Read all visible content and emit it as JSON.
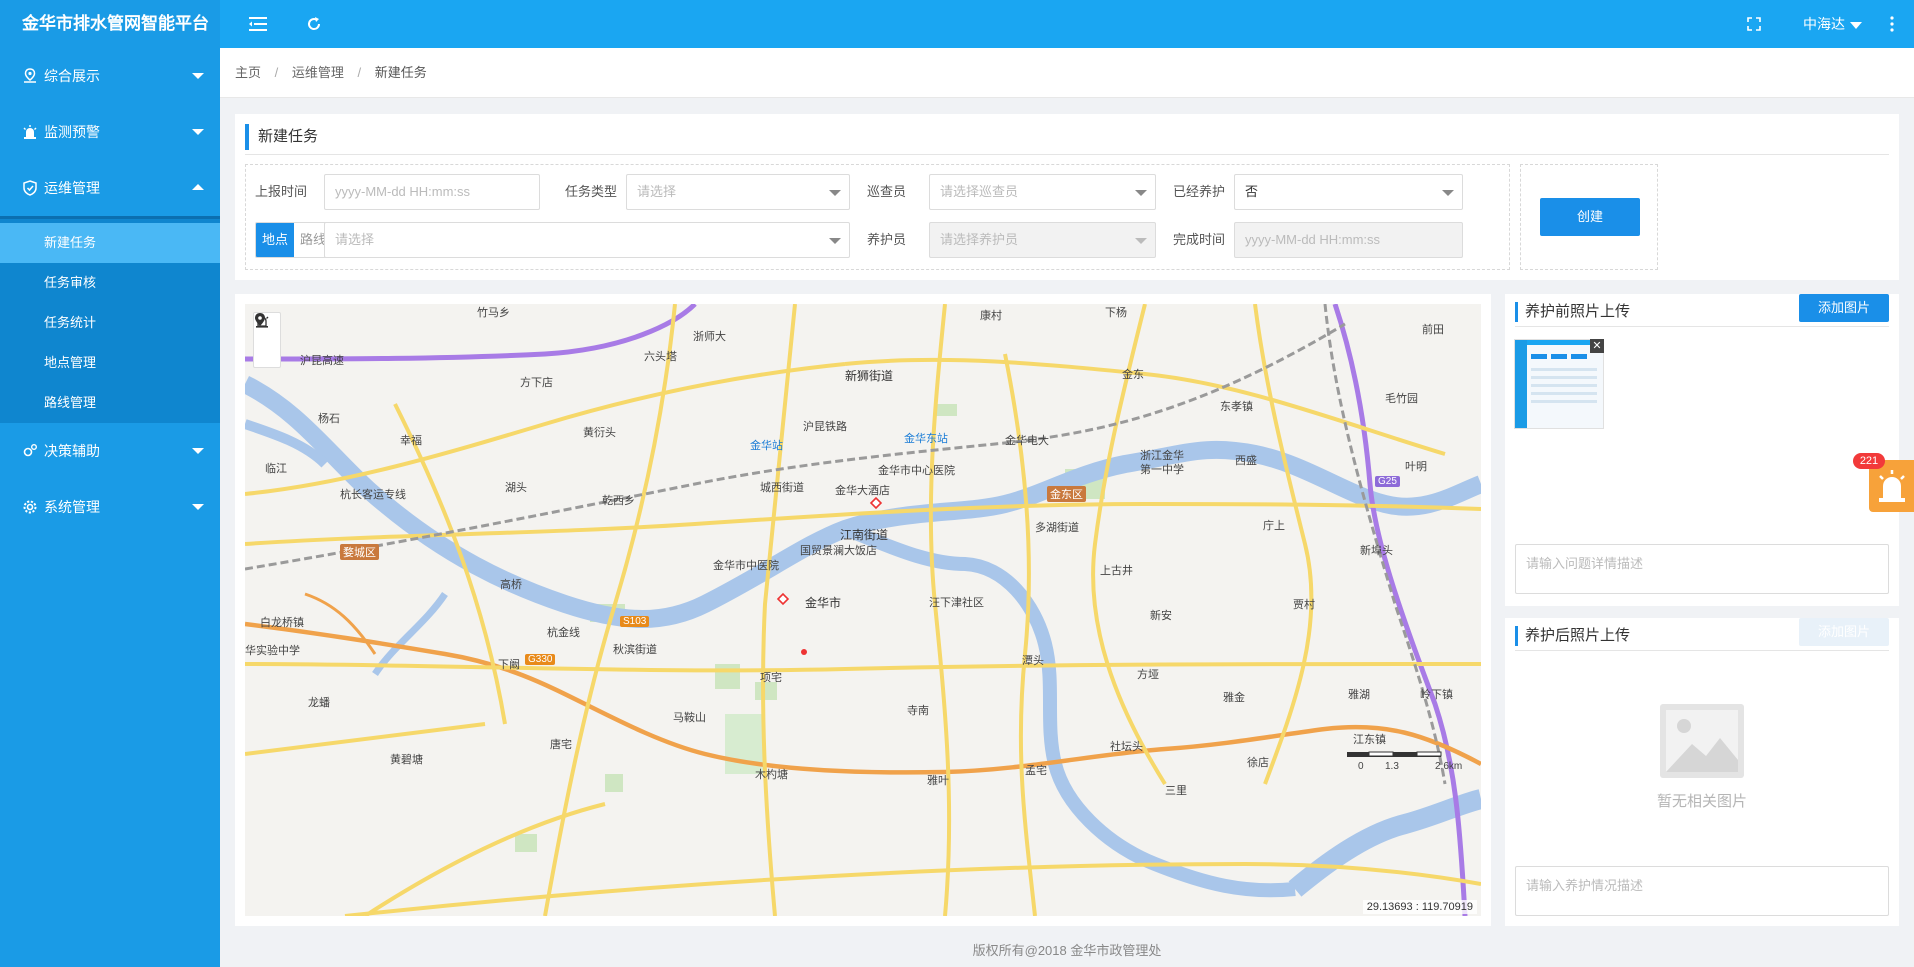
{
  "app": {
    "title": "金华市排水管网智能平台"
  },
  "topbar": {
    "user": "中海达"
  },
  "sidebar": {
    "items": [
      {
        "label": "综合展示",
        "icon": "map-pin-icon"
      },
      {
        "label": "监测预警",
        "icon": "siren-icon"
      },
      {
        "label": "运维管理",
        "icon": "shield-icon",
        "expanded": true
      },
      {
        "label": "决策辅助",
        "icon": "gears-icon"
      },
      {
        "label": "系统管理",
        "icon": "settings-icon"
      }
    ],
    "submenu": [
      {
        "label": "新建任务",
        "active": true
      },
      {
        "label": "任务审核"
      },
      {
        "label": "任务统计"
      },
      {
        "label": "地点管理"
      },
      {
        "label": "路线管理"
      }
    ]
  },
  "breadcrumb": {
    "home": "主页",
    "section": "运维管理",
    "current": "新建任务",
    "sep": "/"
  },
  "task_panel": {
    "title": "新建任务",
    "report_time": {
      "label": "上报时间",
      "placeholder": "yyyy-MM-dd HH:mm:ss"
    },
    "task_type": {
      "label": "任务类型",
      "placeholder": "请选择"
    },
    "inspector": {
      "label": "巡查员",
      "placeholder": "请选择巡查员"
    },
    "maintained": {
      "label": "已经养护",
      "value": "否"
    },
    "mode_toggle": {
      "point": "地点",
      "route": "路线",
      "active": "地点"
    },
    "location": {
      "placeholder": "请选择"
    },
    "maintainer": {
      "label": "养护员",
      "placeholder": "请选择养护员"
    },
    "finish_time": {
      "label": "完成时间",
      "placeholder": "yyyy-MM-dd HH:mm:ss"
    },
    "create_button": "创建"
  },
  "map": {
    "coords": "29.13693 : 119.70919",
    "scale": {
      "labels": [
        "0",
        "1.3",
        "2.6"
      ],
      "unit": "km"
    },
    "labels": {
      "zhumaxiang": "竹马乡",
      "zheshida": "浙师大",
      "kangcun": "康村",
      "xiayang": "下杨",
      "qiantian": "前田",
      "liutouta": "六头塔",
      "fangxiadian": "方下店",
      "xinshijiedao": "新狮街道",
      "jindong": "金东",
      "dongxiaozhen": "东孝镇",
      "maozhuyuan": "毛竹园",
      "yangshi": "杨石",
      "xingfu": "幸福",
      "huangshantou": "黄衍头",
      "hukunrail": "沪昆铁路",
      "jinhuazhan": "金华站",
      "jinhuadongzhan": "金华东站",
      "jinhuadianda": "金华电大",
      "lijiang": "临江",
      "hutou": "湖头",
      "chengxijiedao": "城西街道",
      "zhongxinyiyuan": "金华市中心医院",
      "jinhuadajiudian": "金华大酒店",
      "zhejiangjinhua": "浙江金华\n第一中学",
      "xisheng": "西盛",
      "yedian": "叶明",
      "hangzhangrail": "杭长客运专线",
      "qianxixiang": "乾西乡",
      "duohujiedao": "多湖街道",
      "jiangnanjiedao": "江南街道",
      "guomao": "国贸景澜大饭店",
      "zhongyiyuan": "金华市中医院",
      "jinhuashi": "金华市",
      "shangguijing": "上古井",
      "anshang": "庁上",
      "xinpaitou": "新埠头",
      "gaoqiao": "高桥",
      "bailongqiao": "白龙桥镇",
      "shiyanzhongxue": "华实验中学",
      "hangjinxian": "杭金线",
      "qiubinjiedao": "秋滨街道",
      "jiangxiajiedao": "汪下津社区",
      "xinan": "新安",
      "beicun": "贾村",
      "xiahan": "下阚",
      "tangxia": "潭头",
      "fangya": "方垭",
      "yaguan": "雅金",
      "yahu": "雅湖",
      "lingxia": "岭下镇",
      "longpu": "龙蟠",
      "xiangzhai": "项宅",
      "sinan": "寺南",
      "mashan": "马鞍山",
      "jiangdongzhen": "江东镇",
      "tangzhai": "唐宅",
      "huangbi": "黄碧塘",
      "mudu": "木杓塘",
      "yayu": "雅叶",
      "mengzhai": "孟宅",
      "xuzhai": "徐店",
      "sanli": "三里",
      "zaipu": "社坛头",
      "wuyi": "沪昆高速"
    },
    "badges": {
      "jindongqu": "金东区",
      "wuchengqu": "婺城区"
    },
    "roads": {
      "s103": "S103",
      "g330": "G330",
      "g25": "G25"
    }
  },
  "before_upload": {
    "title": "养护前照片上传",
    "add_button": "添加图片",
    "desc_placeholder": "请输入问题详情描述"
  },
  "after_upload": {
    "title": "养护后照片上传",
    "add_button": "添加图片",
    "empty_text": "暂无相关图片",
    "desc_placeholder": "请输入养护情况描述"
  },
  "alarm": {
    "count": "221"
  },
  "footer": {
    "copyright": "版权所有@2018 金华市政管理处"
  }
}
